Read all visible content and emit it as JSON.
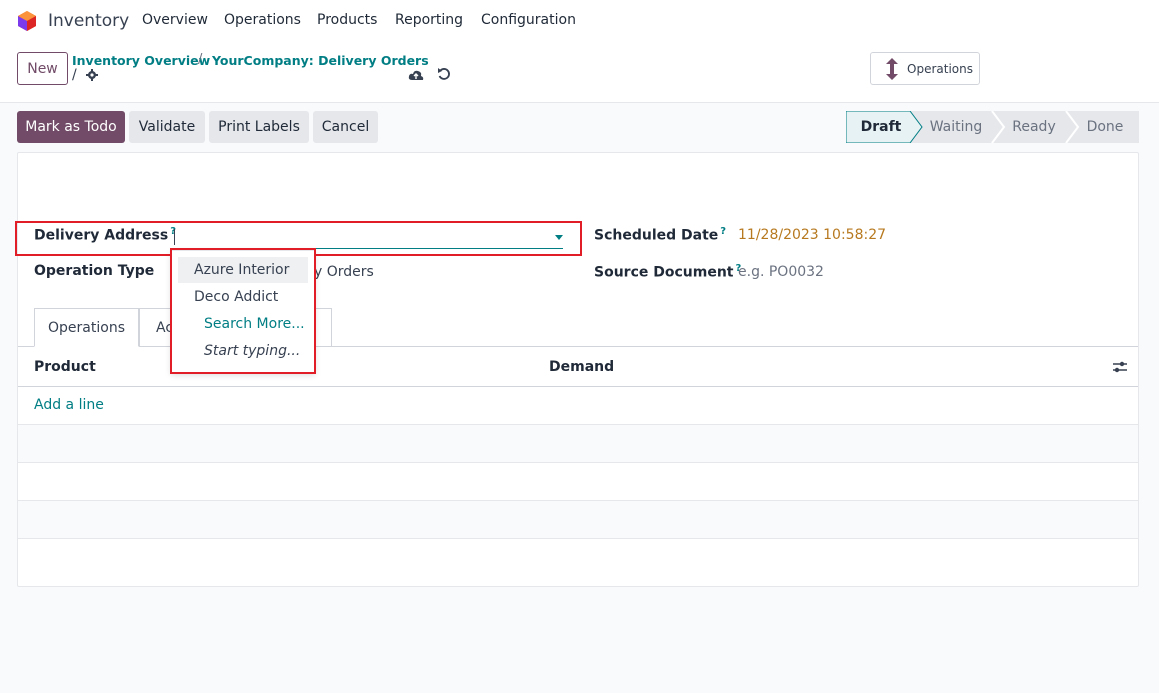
{
  "navbar": {
    "app_name": "Inventory",
    "menu": [
      "Overview",
      "Operations",
      "Products",
      "Reporting",
      "Configuration"
    ]
  },
  "control": {
    "new_label": "New",
    "breadcrumb": [
      "Inventory Overview",
      "YourCompany: Delivery Orders"
    ],
    "breadcrumb_separator": "/",
    "operations_button": "Operations"
  },
  "actions": {
    "mark_todo": "Mark as Todo",
    "validate": "Validate",
    "print_labels": "Print Labels",
    "cancel": "Cancel"
  },
  "status": {
    "steps": [
      "Draft",
      "Waiting",
      "Ready",
      "Done"
    ],
    "current": "Draft"
  },
  "form": {
    "delivery_address_label": "Delivery Address",
    "delivery_address_value": "",
    "help_mark": "?",
    "operation_type_label": "Operation Type",
    "operation_type_value_visible": "y Orders",
    "scheduled_date_label": "Scheduled Date",
    "scheduled_date_value": "11/28/2023 10:58:27",
    "source_document_label": "Source Document",
    "source_document_placeholder": "e.g. PO0032"
  },
  "dropdown": {
    "items": [
      "Azure Interior",
      "Deco Addict"
    ],
    "search_more": "Search More...",
    "start_typing": "Start typing..."
  },
  "tabs": [
    "Operations",
    "Ac"
  ],
  "table": {
    "columns": [
      "Product",
      "Demand"
    ],
    "add_line": "Add a line"
  },
  "colors": {
    "primary": "#714B67",
    "link": "#017e84",
    "highlight": "#e11d27",
    "date": "#b7791f"
  }
}
